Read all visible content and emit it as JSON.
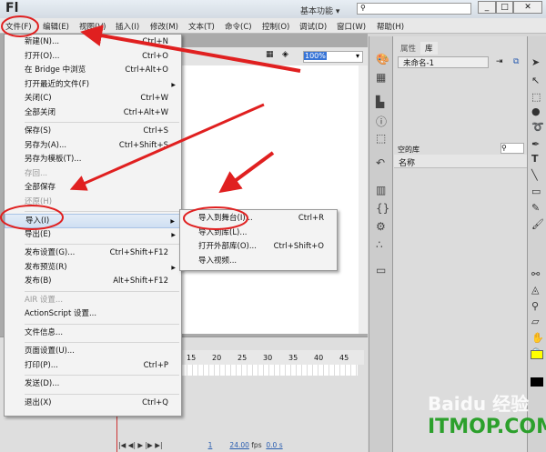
{
  "app": {
    "logo": "Fl",
    "workspace": "基本功能 ▾",
    "search_placeholder": "",
    "window_buttons": [
      "_",
      "□",
      "✕"
    ]
  },
  "menubar": [
    "文件(F)",
    "编辑(E)",
    "视图(V)",
    "插入(I)",
    "修改(M)",
    "文本(T)",
    "命令(C)",
    "控制(O)",
    "调试(D)",
    "窗口(W)",
    "帮助(H)"
  ],
  "stage": {
    "zoom": "100%"
  },
  "file_menu": [
    {
      "label": "新建(N)...",
      "shortcut": "Ctrl+N"
    },
    {
      "label": "打开(O)...",
      "shortcut": "Ctrl+O"
    },
    {
      "label": "在 Bridge 中浏览",
      "shortcut": "Ctrl+Alt+O"
    },
    {
      "label": "打开最近的文件(F)",
      "submenu": true
    },
    {
      "label": "关闭(C)",
      "shortcut": "Ctrl+W"
    },
    {
      "label": "全部关闭",
      "shortcut": "Ctrl+Alt+W"
    },
    {
      "sep": true
    },
    {
      "label": "保存(S)",
      "shortcut": "Ctrl+S"
    },
    {
      "label": "另存为(A)...",
      "shortcut": "Ctrl+Shift+S"
    },
    {
      "label": "另存为模板(T)..."
    },
    {
      "label": "存回...",
      "disabled": true
    },
    {
      "label": "全部保存"
    },
    {
      "label": "还原(H)",
      "disabled": true
    },
    {
      "sep": true
    },
    {
      "label": "导入(I)",
      "submenu": true,
      "highlighted": true
    },
    {
      "label": "导出(E)",
      "submenu": true
    },
    {
      "sep": true
    },
    {
      "label": "发布设置(G)...",
      "shortcut": "Ctrl+Shift+F12"
    },
    {
      "label": "发布预览(R)",
      "submenu": true
    },
    {
      "label": "发布(B)",
      "shortcut": "Alt+Shift+F12"
    },
    {
      "sep": true
    },
    {
      "label": "AIR 设置...",
      "disabled": true
    },
    {
      "label": "ActionScript 设置..."
    },
    {
      "sep": true
    },
    {
      "label": "文件信息..."
    },
    {
      "sep": true
    },
    {
      "label": "页面设置(U)..."
    },
    {
      "label": "打印(P)...",
      "shortcut": "Ctrl+P"
    },
    {
      "sep": true
    },
    {
      "label": "发送(D)..."
    },
    {
      "sep": true
    },
    {
      "label": "退出(X)",
      "shortcut": "Ctrl+Q"
    }
  ],
  "import_submenu": [
    {
      "label": "导入到舞台(I)...",
      "shortcut": "Ctrl+R"
    },
    {
      "label": "导入到库(L)..."
    },
    {
      "label": "打开外部库(O)...",
      "shortcut": "Ctrl+Shift+O"
    },
    {
      "label": "导入视频..."
    }
  ],
  "timeline": {
    "ruler": [
      "15",
      "20",
      "25",
      "30",
      "35",
      "40",
      "45"
    ],
    "frame": "1",
    "fps": "24.00",
    "fps_unit": "fps",
    "time": "0.0 s"
  },
  "library": {
    "tabs": [
      "属性",
      "库"
    ],
    "document": "未命名-1",
    "empty_label": "空的库",
    "column": "名称"
  },
  "colors": {
    "fill": "#ffff00",
    "stroke": "#000000",
    "annotation": "#e02020",
    "highlight": "#3875d7"
  },
  "watermark": {
    "baidu": "Baidu 经验",
    "itmop": "ITMOP.COM"
  }
}
